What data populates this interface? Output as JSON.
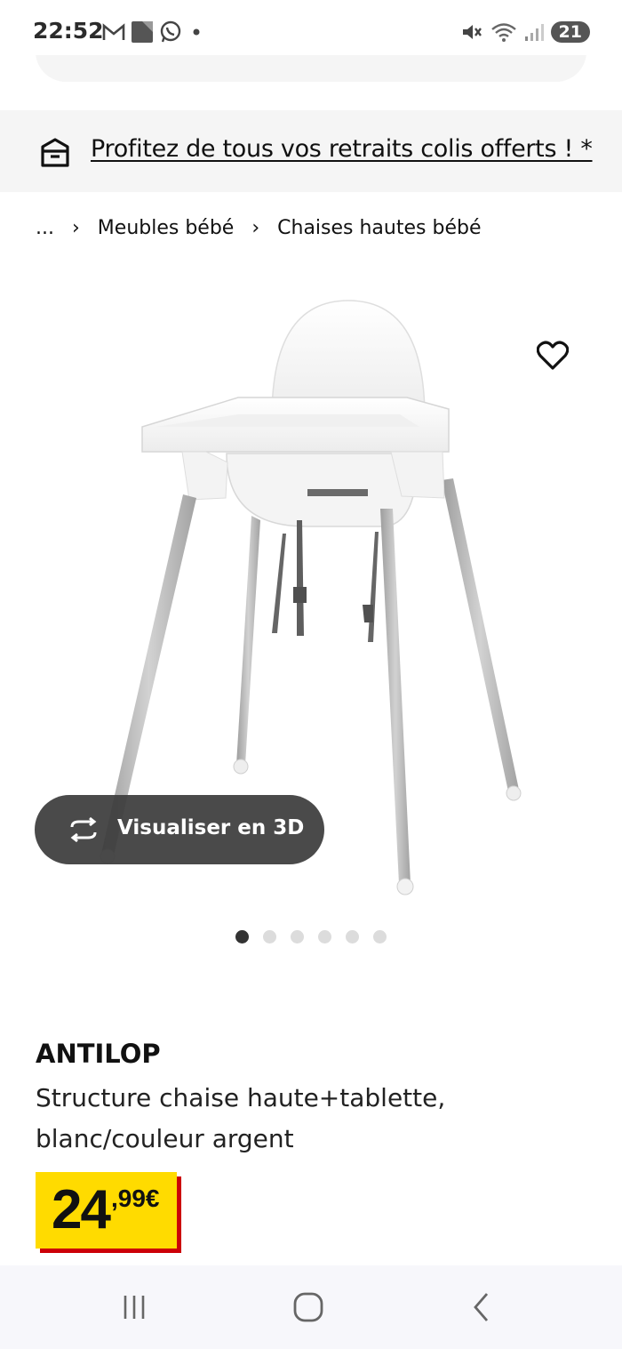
{
  "status_bar": {
    "time": "22:52",
    "notification_count": "21",
    "icons": [
      "gmail-icon",
      "app-icon",
      "whatsapp-icon",
      "dot-icon",
      "mute-icon",
      "wifi-icon",
      "signal-icon"
    ]
  },
  "promo": {
    "text": "Profitez de tous vos retraits colis offerts ! *",
    "icon": "parcel-box-icon"
  },
  "breadcrumb": {
    "ellipsis": "...",
    "items": [
      "Meubles bébé",
      "Chaises hautes bébé"
    ]
  },
  "gallery": {
    "view_3d_label": "Visualiser en 3D",
    "dot_count": 6,
    "active_index": 0
  },
  "product": {
    "name": "ANTILOP",
    "description": "Structure chaise haute+tablette, blanc/couleur argent",
    "price_integer": "24",
    "price_decimal": ",99€"
  },
  "colors": {
    "price_background": "#ffdb00",
    "price_shadow": "#cc0008",
    "banner_background": "#f5f5f5",
    "pill_background": "#3c3c3c"
  }
}
